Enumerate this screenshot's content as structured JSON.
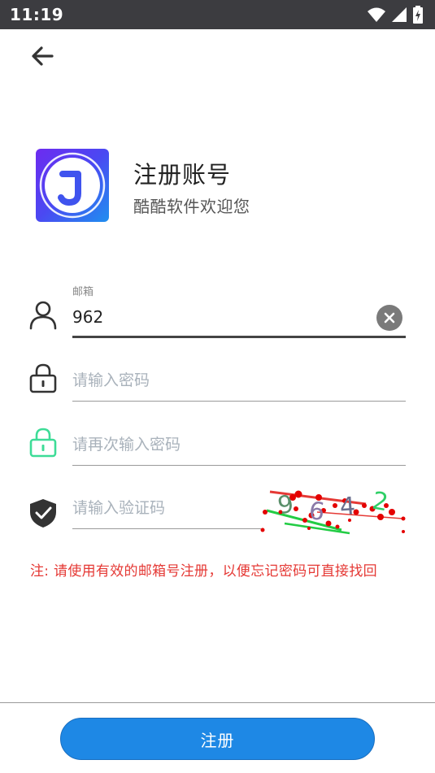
{
  "status_bar": {
    "time": "11:19"
  },
  "header": {
    "title": "注册账号",
    "subtitle": "酷酷软件欢迎您"
  },
  "form": {
    "email": {
      "label": "邮箱",
      "value": "962"
    },
    "password": {
      "placeholder": "请输入密码"
    },
    "confirm_password": {
      "placeholder": "请再次输入密码"
    },
    "captcha": {
      "placeholder": "请输入验证码",
      "code": [
        "9",
        "6",
        "4",
        "2"
      ],
      "code_colors": [
        "#5a8f6a",
        "#8a7aa8",
        "#6a6e8e",
        "#2fcf66"
      ]
    }
  },
  "notice": "注: 请使用有效的邮箱号注册，以便忘记密码可直接找回",
  "actions": {
    "register_label": "注册"
  },
  "colors": {
    "accent": "#1e88e5",
    "notice": "#e53935",
    "confirm_icon": "#3ddc97",
    "status_bar": "#3c3c40"
  }
}
